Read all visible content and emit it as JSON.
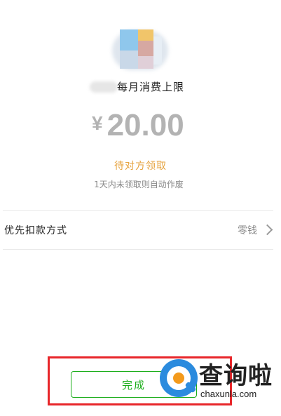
{
  "gift": {
    "title": "每月消费上限",
    "currency": "¥",
    "amount": "20.00",
    "status": "待对方领取",
    "note": "1天内未领取则自动作废"
  },
  "payment": {
    "label": "优先扣款方式",
    "value": "零钱"
  },
  "footer": {
    "done_label": "完成"
  },
  "watermark": {
    "title": "查询啦",
    "url": "chaxunla.com"
  },
  "colors": {
    "accent_green": "#1aad19",
    "status_orange": "#e6a23c",
    "highlight_red": "#e8262a"
  }
}
